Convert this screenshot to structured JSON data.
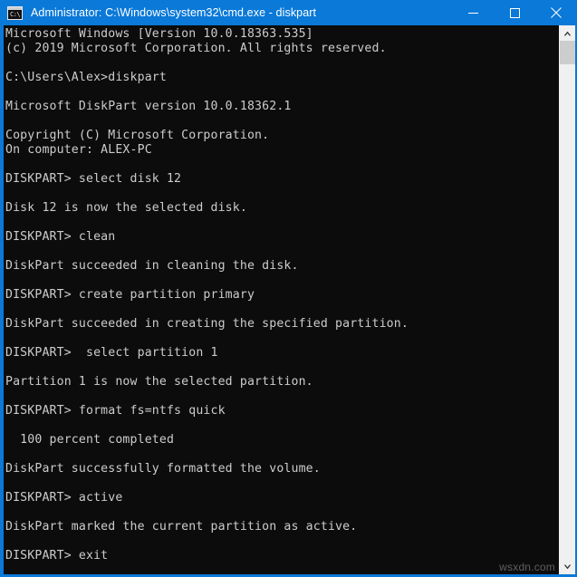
{
  "window": {
    "title": "Administrator: C:\\Windows\\system32\\cmd.exe - diskpart",
    "icon_name": "cmd-console-icon",
    "icon_prompt_text": "C:\\",
    "titlebar_color": "#0a79d8",
    "console_background": "#0c0c0c",
    "console_foreground": "#cccccc"
  },
  "titlebar_buttons": {
    "minimize_label": "Minimize",
    "maximize_label": "Maximize",
    "close_label": "Close"
  },
  "scrollbar": {
    "up_arrow_label": "Scroll up",
    "down_arrow_label": "Scroll down",
    "thumb_label": "Scrollbar thumb"
  },
  "watermark": {
    "text": "wsxdn.com"
  },
  "console": {
    "lines": [
      "Microsoft Windows [Version 10.0.18363.535]",
      "(c) 2019 Microsoft Corporation. All rights reserved.",
      "",
      "C:\\Users\\Alex>diskpart",
      "",
      "Microsoft DiskPart version 10.0.18362.1",
      "",
      "Copyright (C) Microsoft Corporation.",
      "On computer: ALEX-PC",
      "",
      "DISKPART> select disk 12",
      "",
      "Disk 12 is now the selected disk.",
      "",
      "DISKPART> clean",
      "",
      "DiskPart succeeded in cleaning the disk.",
      "",
      "DISKPART> create partition primary",
      "",
      "DiskPart succeeded in creating the specified partition.",
      "",
      "DISKPART>  select partition 1",
      "",
      "Partition 1 is now the selected partition.",
      "",
      "DISKPART> format fs=ntfs quick",
      "",
      "  100 percent completed",
      "",
      "DiskPart successfully formatted the volume.",
      "",
      "DISKPART> active",
      "",
      "DiskPart marked the current partition as active.",
      "",
      "DISKPART> exit",
      ""
    ]
  }
}
